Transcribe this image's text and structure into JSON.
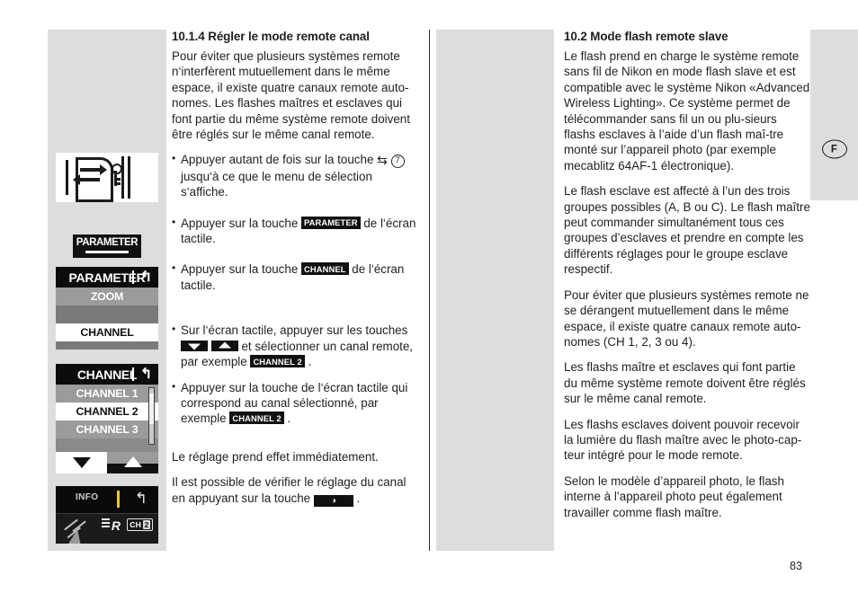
{
  "page": {
    "number": "83",
    "language_tab": "F"
  },
  "left_column": {
    "heading": "10.1.4 Régler le mode remote canal",
    "intro": "Pour éviter que plusieurs systèmes remote n‘interfèrent mutuellement dans le même espace, il existe quatre canaux remote auto-nomes. Les flashes maîtres et esclaves qui font partie du même système remote doivent être réglés sur le même canal remote.",
    "bullets": [
      {
        "text_before": "Appuyer autant de fois sur la touche",
        "glyph": "⇆",
        "circled_number": "7",
        "text_after": "jusqu‘à ce que le menu de sélection s‘affiche."
      },
      {
        "text_before": "Appuyer sur la touche",
        "chip": "PARAMETER",
        "text_after": "de l‘écran tactile."
      },
      {
        "text_before": "Appuyer sur la touche",
        "chip": "CHANNEL",
        "text_after": "de l‘écran tactile."
      },
      {
        "text_before": "Sur l‘écran tactile, appuyer sur les touches",
        "arrow_down": "▼",
        "arrow_up": "▲",
        "text_middle": "et sélectionner un canal remote, par exemple",
        "chip": "CHANNEL 2",
        "text_after": "."
      },
      {
        "text_before": "Appuyer sur la touche de l‘écran tactile qui correspond au canal sélectionné, par exemple",
        "chip": "CHANNEL 2",
        "text_after": "."
      }
    ],
    "closing_1": "Le réglage prend effet immédiatement.",
    "closing_2_before": "Il est possible de vérifier le réglage du canal en appuyant sur la touche",
    "closing_2_chip": "◑",
    "closing_2_after": "."
  },
  "right_column": {
    "heading": "10.2 Mode flash remote slave",
    "paragraphs": [
      "Le flash prend en charge le système remote sans fil de Nikon en mode flash slave et est compatible avec le système Nikon «Advanced Wireless Lighting». Ce système permet de télécommander sans fil un ou plu-sieurs flashs esclaves à l’aide d’un flash maî-tre monté sur l’appareil photo (par exemple mecablitz 64AF-1 électronique).",
      "Le flash esclave est affecté à l’un des trois groupes possibles (A, B ou C). Le flash maître peut commander simultanément tous ces groupes d’esclaves et prendre en compte les différents réglages pour le groupe esclave respectif.",
      "Pour éviter que plusieurs systèmes remote ne se dérangent mutuellement dans le même espace, il existe quatre canaux remote auto-nomes (CH 1, 2, 3 ou 4).",
      "Les flashs maître et esclaves qui font partie du même système remote doivent être réglés sur le même canal remote.",
      "Les flashs esclaves doivent pouvoir recevoir la lumière du flash maître avec le photo-cap-teur intégré pour le mode remote.",
      "Selon le modèle d’appareil photo, le flash interne à l’appareil photo peut également travailler comme flash maître."
    ]
  },
  "figures": {
    "mode_button": {
      "name": "mode-switch-button-photo"
    },
    "parameter_key": {
      "label": "PARAMETER"
    },
    "parameter_screen": {
      "title": "PARAMETER",
      "back_glyph": "↰",
      "rows": [
        {
          "label": "ZOOM",
          "state": "normal"
        },
        {
          "label": "CHANNEL",
          "state": "selected"
        }
      ]
    },
    "channel_screen": {
      "title": "CHANNEL",
      "back_glyph": "↰",
      "rows": [
        {
          "label": "CHANNEL 1",
          "state": "normal"
        },
        {
          "label": "CHANNEL 2",
          "state": "selected"
        },
        {
          "label": "CHANNEL 3",
          "state": "normal"
        }
      ],
      "nav_down": "▼",
      "nav_up": "▲"
    },
    "info_screen": {
      "label": "INFO",
      "back_glyph": "↰",
      "remote_mark": "R",
      "channel_badge_prefix": "CH",
      "channel_badge_value": "2"
    }
  },
  "colors": {
    "figure_panel_bg": "#dcdddf",
    "lcd_title_bg": "#0c0c0c",
    "lcd_row_bg": "#9b9b9b",
    "lcd_selected_bg": "#ffffff",
    "chip_bg": "#111111",
    "accent_yellow": "#e8c92c",
    "text": "#1f1f1f"
  }
}
